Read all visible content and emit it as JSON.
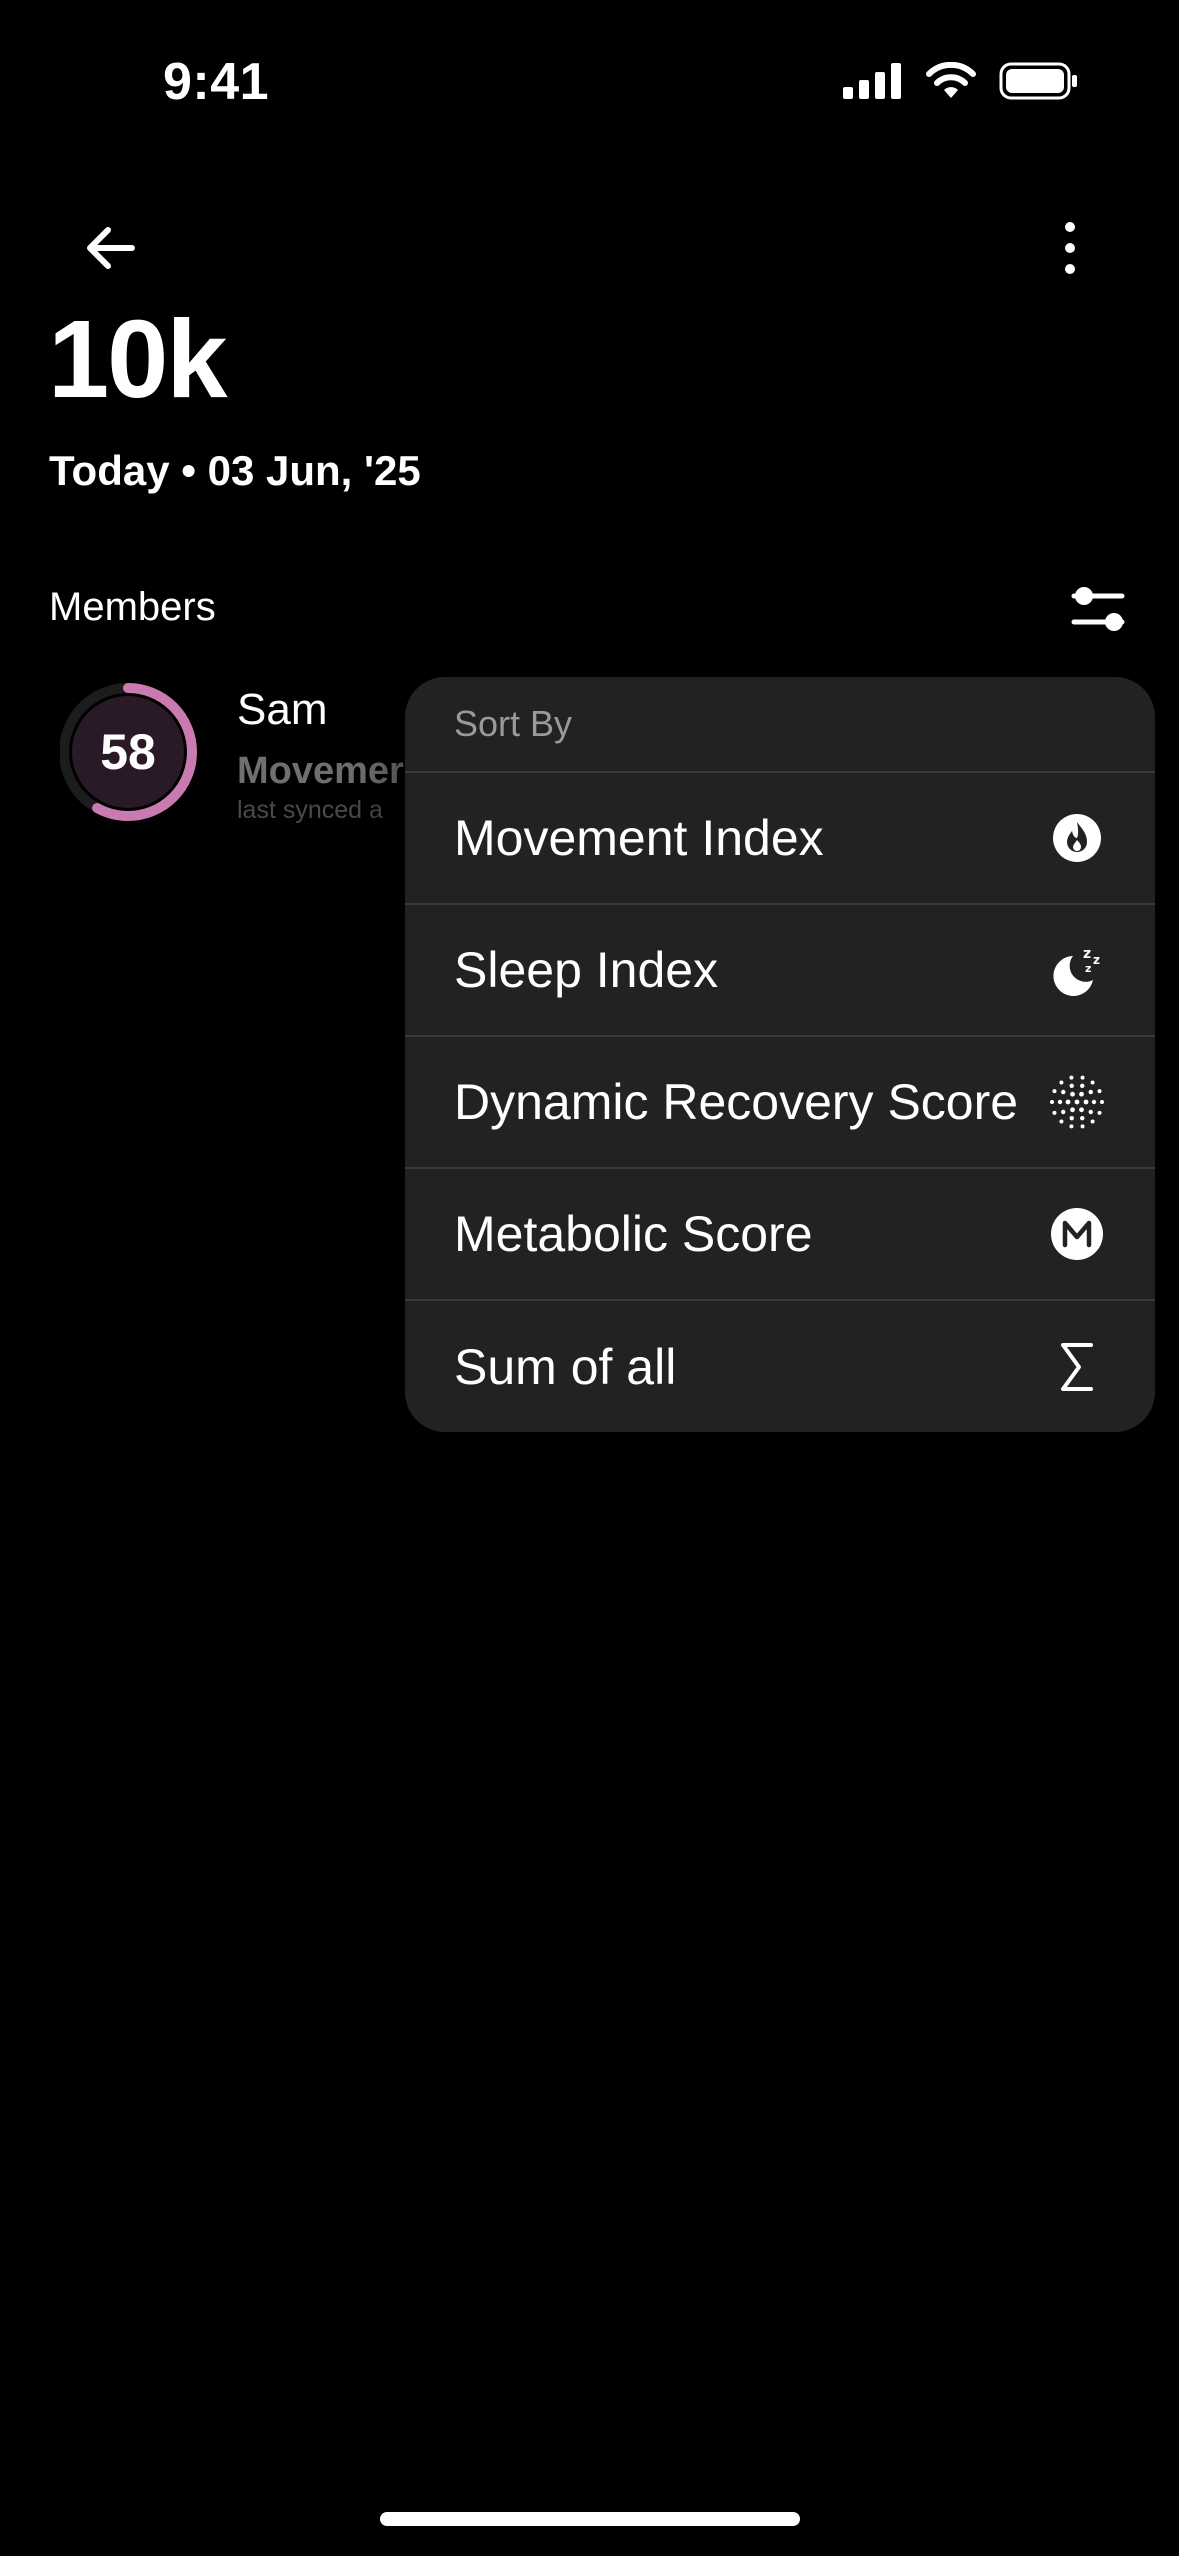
{
  "status_bar": {
    "time": "9:41"
  },
  "header": {
    "title": "10k",
    "date": "Today • 03 Jun, '25"
  },
  "members": {
    "label": "Members",
    "items": [
      {
        "score": "58",
        "score_fraction": 0.58,
        "ring_color": "#c97bb1",
        "name": "Sam",
        "metric": "Movemer",
        "synced": "last synced a"
      }
    ]
  },
  "sort_menu": {
    "title": "Sort By",
    "items": [
      {
        "label": "Movement Index",
        "icon": "flame-icon"
      },
      {
        "label": "Sleep Index",
        "icon": "moon-sleep-icon"
      },
      {
        "label": "Dynamic Recovery Score",
        "icon": "dots-circle-icon"
      },
      {
        "label": "Metabolic Score",
        "icon": "metabolic-m-icon"
      },
      {
        "label": "Sum of all",
        "icon": "sigma-icon"
      }
    ]
  },
  "colors": {
    "background": "#000000",
    "menu_background": "#222222",
    "accent": "#c97bb1"
  }
}
